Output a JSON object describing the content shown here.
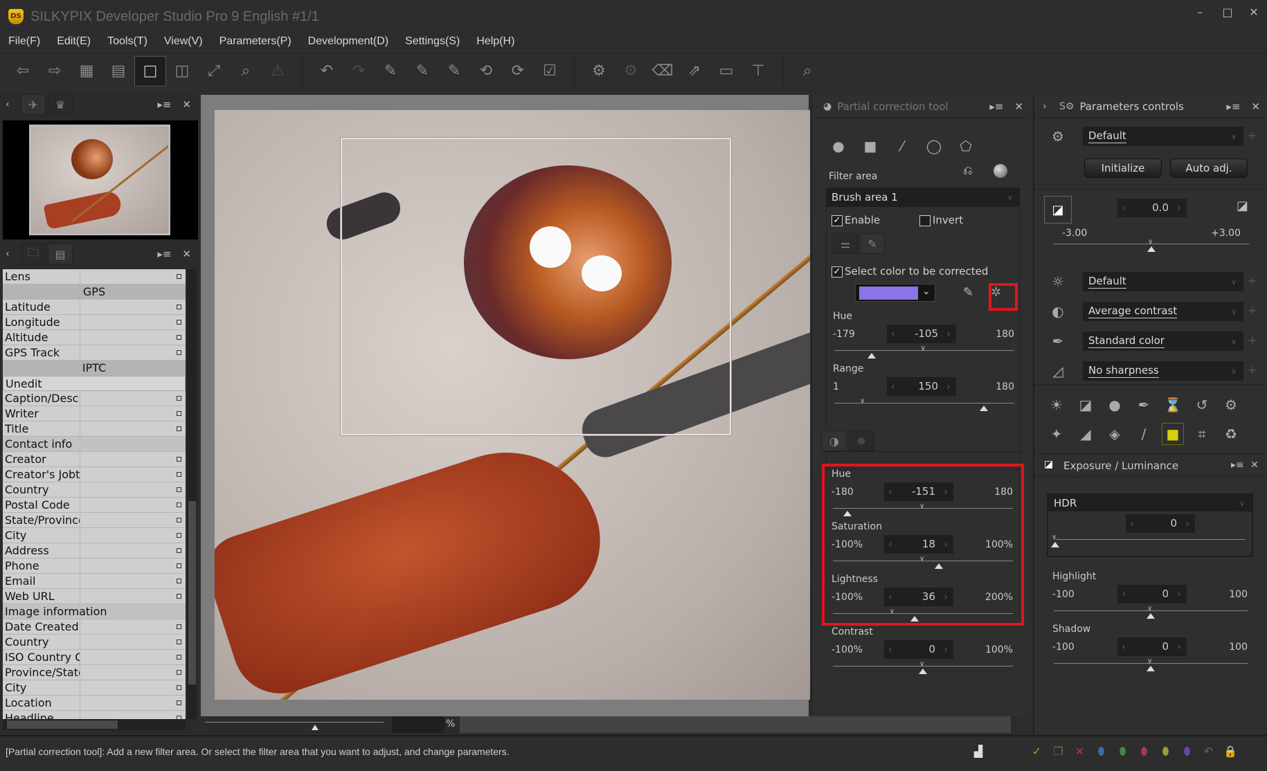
{
  "app": {
    "title": "SILKYPIX Developer Studio Pro 9 English   #1/1",
    "logo": "DS"
  },
  "window_controls": [
    "minimize",
    "maximize",
    "close"
  ],
  "menu": [
    "File(F)",
    "Edit(E)",
    "Tools(T)",
    "View(V)",
    "Parameters(P)",
    "Development(D)",
    "Settings(S)",
    "Help(H)"
  ],
  "toolbar": [
    {
      "icon": "previous-image-icon",
      "glyph": "⇦",
      "state": "normal"
    },
    {
      "icon": "next-image-icon",
      "glyph": "⇨",
      "state": "normal"
    },
    {
      "icon": "thumbnail-grid-icon",
      "glyph": "▦",
      "state": "normal"
    },
    {
      "icon": "thumbnail-preview-icon",
      "glyph": "▤",
      "state": "normal"
    },
    {
      "icon": "single-preview-icon",
      "glyph": "□",
      "state": "active"
    },
    {
      "icon": "compare-view-icon",
      "glyph": "◫",
      "state": "normal"
    },
    {
      "icon": "full-screen-icon",
      "glyph": "⤢",
      "state": "normal"
    },
    {
      "icon": "zoom-loupe-icon",
      "glyph": "⌕",
      "state": "normal"
    },
    {
      "icon": "warning-icon",
      "glyph": "⚠",
      "state": "dim"
    },
    {
      "sep": true
    },
    {
      "icon": "undo-icon",
      "glyph": "↶",
      "state": "normal"
    },
    {
      "icon": "redo-icon",
      "glyph": "↷",
      "state": "dim"
    },
    {
      "icon": "exposure-dropper-icon",
      "glyph": "✎",
      "state": "normal"
    },
    {
      "icon": "gray-balance-dropper-icon",
      "glyph": "✎",
      "state": "normal"
    },
    {
      "icon": "white-balance-dropper-icon",
      "glyph": "✎",
      "state": "normal"
    },
    {
      "icon": "rotate-left-icon",
      "glyph": "⟲",
      "state": "normal"
    },
    {
      "icon": "rotate-right-icon",
      "glyph": "⟳",
      "state": "normal"
    },
    {
      "icon": "mark-check-icon",
      "glyph": "☑",
      "state": "normal"
    },
    {
      "sep": true
    },
    {
      "icon": "save-parameters-icon",
      "glyph": "⚙",
      "state": "normal"
    },
    {
      "icon": "apply-parameters-icon",
      "glyph": "⚙",
      "state": "dim"
    },
    {
      "icon": "eraser-icon",
      "glyph": "⌫",
      "state": "normal"
    },
    {
      "icon": "export-icon",
      "glyph": "⇗",
      "state": "normal"
    },
    {
      "icon": "monitor-icon",
      "glyph": "▭",
      "state": "normal"
    },
    {
      "icon": "develop-icon",
      "glyph": "⊤",
      "state": "normal"
    },
    {
      "sep": true
    },
    {
      "icon": "search-person-icon",
      "glyph": "⌕",
      "state": "normal"
    }
  ],
  "left_panel": {
    "metadata": [
      {
        "type": "field",
        "label": "Lens"
      },
      {
        "type": "section",
        "label": "GPS"
      },
      {
        "type": "field",
        "label": "Latitude"
      },
      {
        "type": "field",
        "label": "Longitude"
      },
      {
        "type": "field",
        "label": "Altitude"
      },
      {
        "type": "field",
        "label": "GPS Track"
      },
      {
        "type": "section",
        "label": "IPTC"
      },
      {
        "type": "select",
        "label": "Unedit"
      },
      {
        "type": "field",
        "label": "Caption/Descr"
      },
      {
        "type": "field",
        "label": "Writer"
      },
      {
        "type": "field",
        "label": "Title"
      },
      {
        "type": "sub",
        "label": "Contact info"
      },
      {
        "type": "field",
        "label": "Creator"
      },
      {
        "type": "field",
        "label": "Creator's Jobti"
      },
      {
        "type": "field",
        "label": "Country"
      },
      {
        "type": "field",
        "label": "Postal Code"
      },
      {
        "type": "field",
        "label": "State/Province"
      },
      {
        "type": "field",
        "label": "City"
      },
      {
        "type": "field",
        "label": "Address"
      },
      {
        "type": "field",
        "label": "Phone"
      },
      {
        "type": "field",
        "label": "Email"
      },
      {
        "type": "field",
        "label": "Web URL"
      },
      {
        "type": "sub",
        "label": "Image information"
      },
      {
        "type": "field",
        "label": "Date Created"
      },
      {
        "type": "field",
        "label": "Country"
      },
      {
        "type": "field",
        "label": "ISO Country C"
      },
      {
        "type": "field",
        "label": "Province/State"
      },
      {
        "type": "field",
        "label": "City"
      },
      {
        "type": "field",
        "label": "Location"
      },
      {
        "type": "field",
        "label": "Headline"
      }
    ]
  },
  "viewer": {
    "zoom_unit": "%"
  },
  "partial_correction": {
    "title": "Partial correction tool",
    "shape_tools": [
      "circle-gradient-icon",
      "rectangle-gradient-icon",
      "brush-icon",
      "ellipse-icon",
      "polygon-icon"
    ],
    "filter_area_label": "Filter area",
    "filter_area_value": "Brush area 1",
    "enable_label": "Enable",
    "enable_checked": true,
    "invert_label": "Invert",
    "invert_checked": false,
    "select_color_label": "Select color to be corrected",
    "select_color_checked": true,
    "selected_color": "#8b74e6",
    "color_sliders": [
      {
        "key": "hue",
        "label": "Hue",
        "min": -179,
        "max": 180,
        "value": -105,
        "min_label": "-179",
        "max_label": "180",
        "default": 0
      },
      {
        "key": "range",
        "label": "Range",
        "min": 1,
        "max": 180,
        "value": 150,
        "min_label": "1",
        "max_label": "180",
        "default": 30
      }
    ],
    "adjust_sliders": [
      {
        "key": "hue",
        "label": "Hue",
        "min": -180,
        "max": 180,
        "value": -151,
        "min_label": "-180",
        "max_label": "180",
        "default": 0
      },
      {
        "key": "saturation",
        "label": "Saturation",
        "min": -100,
        "max": 100,
        "value": 18,
        "min_label": "-100%",
        "max_label": "100%",
        "default": 0
      },
      {
        "key": "lightness",
        "label": "Lightness",
        "min": -100,
        "max": 200,
        "value": 36,
        "min_label": "-100%",
        "max_label": "200%",
        "default": 0
      },
      {
        "key": "contrast",
        "label": "Contrast",
        "min": -100,
        "max": 100,
        "value": 0,
        "min_label": "-100%",
        "max_label": "100%",
        "default": 0
      }
    ],
    "highlight_color": "#e3141e"
  },
  "parameters_controls": {
    "title": "Parameters controls",
    "preset": "Default",
    "initialize_label": "Initialize",
    "auto_adj_label": "Auto adj.",
    "exposure": {
      "value": "0.0",
      "min_label": "-3.00",
      "max_label": "+3.00",
      "min": -3,
      "max": 3,
      "num": 0,
      "default": 0
    },
    "dropdowns": [
      {
        "icon": "white-balance-sun-icon",
        "glyph": "☼",
        "value": "Default"
      },
      {
        "icon": "contrast-icon",
        "glyph": "◐",
        "value": "Average contrast"
      },
      {
        "icon": "color-pen-icon",
        "glyph": "✒",
        "value": "Standard color"
      },
      {
        "icon": "sharpness-icon",
        "glyph": "◿",
        "value": "No sharpness"
      }
    ],
    "tool_grid": [
      "exposure-adjust-icon",
      "tone-curve-icon",
      "noise-reduction-icon",
      "color-adjust-icon",
      "lens-aberration-icon",
      "rotation-icon",
      "advanced-settings-icon",
      "fine-color-icon",
      "shading-icon",
      "fish-eye-icon",
      "brush-retouch-icon",
      "partial-correction-icon",
      "crop-icon",
      "recycle-icon"
    ],
    "tool_grid_glyphs": [
      "☀",
      "◪",
      "●",
      "✒",
      "⌛",
      "↺",
      "⚙",
      "✦",
      "◢",
      "◈",
      "/",
      "■",
      "⌗",
      "♻"
    ]
  },
  "exposure_luminance": {
    "title": "Exposure / Luminance",
    "hdr_label": "HDR",
    "hdr": {
      "min": 0,
      "max": 100,
      "value": 0,
      "default": 0
    },
    "sliders": [
      {
        "key": "highlight",
        "label": "Highlight",
        "min": -100,
        "max": 100,
        "value": 0,
        "min_label": "-100",
        "max_label": "100",
        "default": 0
      },
      {
        "key": "shadow",
        "label": "Shadow",
        "min": -100,
        "max": 100,
        "value": 0,
        "min_label": "-100",
        "max_label": "100",
        "default": 0
      }
    ]
  },
  "status": {
    "message": "[Partial correction tool]: Add a new filter area. Or select the filter area that you want to adjust, and change parameters.",
    "marks": [
      {
        "icon": "ok-mark-icon",
        "color": "#b8962e",
        "glyph": "✓"
      },
      {
        "icon": "copy-mark-icon",
        "color": "#8a6a40",
        "glyph": "❐"
      },
      {
        "icon": "reject-mark-icon",
        "color": "#b33a3a",
        "glyph": "✕"
      },
      {
        "icon": "blue-tag-icon",
        "color": "#3b6ea8",
        "glyph": "⬮"
      },
      {
        "icon": "green-tag-icon",
        "color": "#3e8a48",
        "glyph": "⬮"
      },
      {
        "icon": "red-tag-icon",
        "color": "#a23a55",
        "glyph": "⬮"
      },
      {
        "icon": "yellow-tag-icon",
        "color": "#a39a36",
        "glyph": "⬮"
      },
      {
        "icon": "purple-tag-icon",
        "color": "#6e44a8",
        "glyph": "⬮"
      },
      {
        "icon": "revert-icon",
        "color": "#666666",
        "glyph": "↶"
      },
      {
        "icon": "lock-icon",
        "color": "#7a6a48",
        "glyph": "🔒"
      }
    ]
  }
}
